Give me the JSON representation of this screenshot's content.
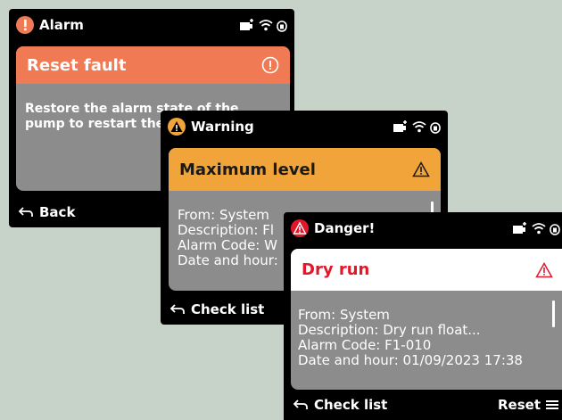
{
  "alarm_screen": {
    "status_title": "Alarm",
    "card_title": "Reset fault",
    "message": [
      "Restore the alarm state of the",
      "pump to restart the pump"
    ],
    "footer_back": "Back"
  },
  "warning_screen": {
    "status_title": "Warning",
    "card_title": "Maximum level",
    "details": [
      "From: System",
      "Description: Fl",
      "Alarm Code: W",
      "Date and hour:"
    ],
    "footer_back": "Check list"
  },
  "danger_screen": {
    "status_title": "Danger!",
    "card_title": "Dry run",
    "details": [
      "From: System",
      "Description: Dry run float...",
      "Alarm Code: F1-010",
      "Date and hour: 01/09/2023 17:38"
    ],
    "footer_back": "Check list",
    "footer_reset": "Reset"
  },
  "icons": {
    "status": [
      "battery-plug-icon",
      "wifi-icon",
      "lock-icon"
    ],
    "alert": "exclamation-icon",
    "warning": "warning-triangle-icon",
    "back": "back-arrow-icon",
    "menu": "menu-icon"
  },
  "colors": {
    "alarm_accent": "#ef7a54",
    "warning_accent": "#f0a43a",
    "danger_accent": "#e0182a",
    "card_body": "#8c8c8c",
    "screen_bg": "#000000",
    "page_bg": "#c7d2c8"
  }
}
